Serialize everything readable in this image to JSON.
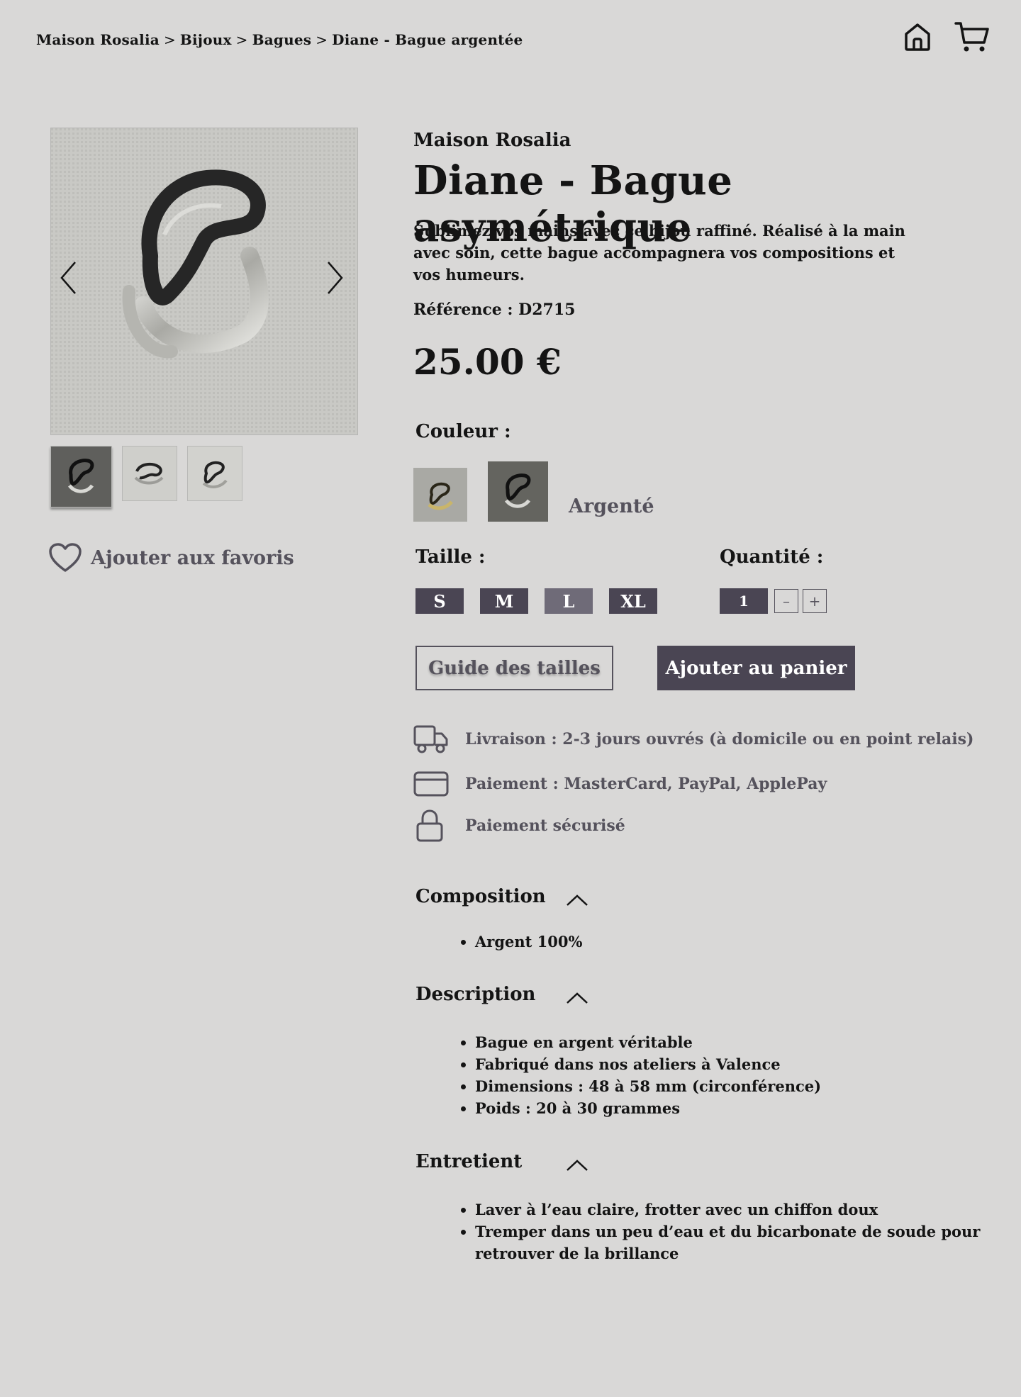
{
  "breadcrumb": [
    "Maison Rosalia",
    "Bijoux",
    "Bagues",
    "Diane - Bague argentée"
  ],
  "breadcrumb_sep": ">",
  "header": {
    "home_icon": "home-icon",
    "cart_icon": "cart-icon"
  },
  "gallery": {
    "prev_icon": "chevron-left-icon",
    "next_icon": "chevron-right-icon",
    "thumb_count": 3
  },
  "favorites": {
    "label": "Ajouter aux favoris",
    "icon": "heart-icon"
  },
  "product": {
    "brand": "Maison Rosalia",
    "title": "Diane - Bague asymétrique",
    "intro": "Sublimez vos mains avec ce bijou raffiné. Réalisé à la main avec soin, cette bague accompagnera vos compositions et vos humeurs.",
    "reference": "Référence : D2715",
    "price": "25.00 €"
  },
  "color": {
    "label": "Couleur :",
    "selected": "Argenté"
  },
  "size": {
    "label": "Taille :",
    "options": [
      "S",
      "M",
      "L",
      "XL"
    ],
    "selected": "L"
  },
  "quantity": {
    "label": "Quantité :",
    "value": "1",
    "minus": "–",
    "plus": "+"
  },
  "buttons": {
    "size_guide": "Guide des tailles",
    "add_to_cart": "Ajouter au panier"
  },
  "info": {
    "delivery": "Livraison : 2-3 jours ouvrés (à domicile ou en point relais)",
    "payment": "Paiement : MasterCard, PayPal, ApplePay",
    "secure": "Paiement sécurisé"
  },
  "sections": {
    "composition": {
      "title": "Composition",
      "items": [
        "Argent 100%"
      ]
    },
    "description": {
      "title": "Description",
      "items": [
        "Bague en argent véritable",
        "Fabriqué dans nos ateliers à Valence",
        "Dimensions : 48 à 58 mm (circonférence)",
        "Poids : 20 à 30 grammes"
      ]
    },
    "care": {
      "title": "Entretient",
      "items": [
        "Laver à l’eau claire, frotter avec un chiffon doux",
        "Tremper dans un peu d’eau et du bicarbonate de soude pour retrouver de la brillance"
      ]
    }
  },
  "colors": {
    "accent": "#4a4553",
    "accent_light": "#6f6b78",
    "muted_text": "#55525c",
    "background": "#d9d8d7"
  }
}
